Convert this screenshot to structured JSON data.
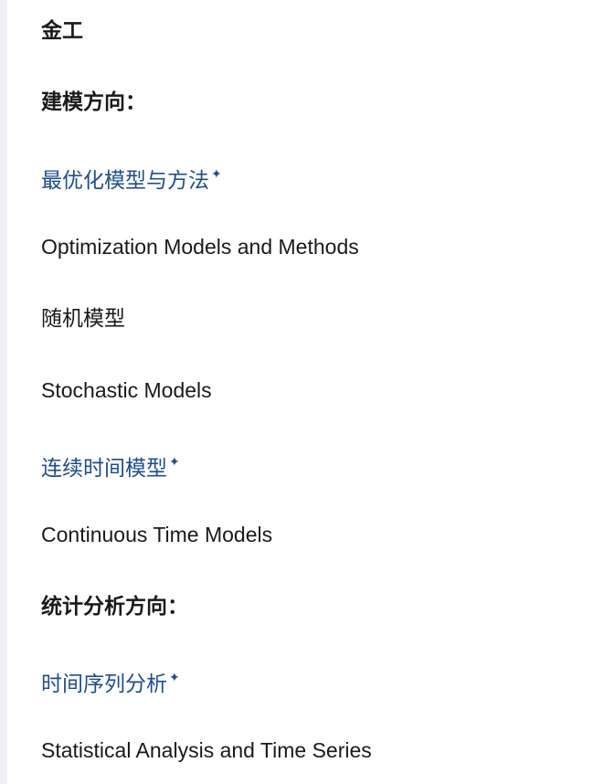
{
  "items": [
    {
      "text": "金工"
    },
    {
      "text": "建模方向："
    },
    {
      "text": "最优化模型与方法",
      "marker": "✦"
    },
    {
      "text": "Optimization Models and Methods"
    },
    {
      "text": "随机模型"
    },
    {
      "text": "Stochastic Models"
    },
    {
      "text": "连续时间模型",
      "marker": "✦"
    },
    {
      "text": "Continuous Time Models"
    },
    {
      "text": "统计分析方向："
    },
    {
      "text": "时间序列分析",
      "marker": "✦"
    },
    {
      "text": "Statistical Analysis and Time Series"
    }
  ],
  "colors": {
    "text": "#1a1a1a",
    "link": "#1f4e8c",
    "sidebar_rule": "#eef0f3"
  },
  "icons": {
    "link_marker": "sparkle-icon"
  }
}
